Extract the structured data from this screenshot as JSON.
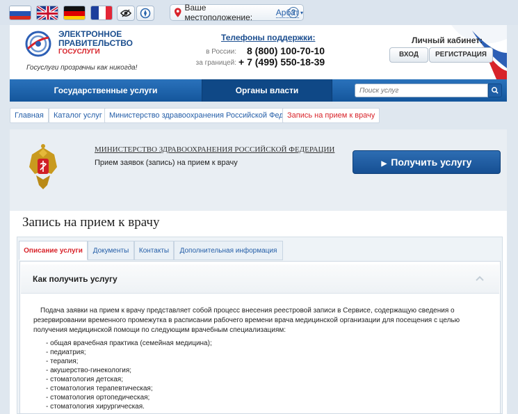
{
  "location": {
    "label": "Ваше местоположение:",
    "city": "Арбат",
    "help": "?"
  },
  "logo": {
    "line1": "ЭЛЕКТРОННОЕ",
    "line2": "ПРАВИТЕЛЬСТВО",
    "line3": "ГОСУСЛУГИ",
    "slogan": "Госуслуги прозрачны как никогда!"
  },
  "phones": {
    "title": "Телефоны поддержки:",
    "russia_label": "в России:",
    "russia_number": "8 (800) 100-70-10",
    "abroad_label": "за границей:",
    "abroad_number": "+ 7 (499) 550-18-39"
  },
  "cabinet": {
    "title": "Личный кабинет:",
    "login": "ВХОД",
    "register": "РЕГИСТРАЦИЯ"
  },
  "nav": {
    "services": "Государственные услуги",
    "authorities": "Органы власти",
    "search_placeholder": "Поиск услуг"
  },
  "breadcrumbs": [
    "Главная",
    "Каталог услуг",
    "Министерство здравоохранения Российской Федерации",
    "Запись на прием к врачу"
  ],
  "service": {
    "org": "МИНИСТЕРСТВО ЗДРАВООХРАНЕНИЯ РОССИЙСКОЙ ФЕДЕРАЦИИ",
    "name": "Прием заявок (запись) на прием к врачу",
    "get_button": "Получить услугу"
  },
  "page_title": "Запись на прием к врачу",
  "tabs": [
    "Описание услуги",
    "Документы",
    "Контакты",
    "Дополнительная информация"
  ],
  "accordion": {
    "title": "Как получить услугу"
  },
  "description": {
    "text": "Подача заявки на прием к врачу представляет собой процесс внесения реестровой записи в Сервисе, содержащую сведения о резервировании временного промежутка в расписании рабочего времени врача медицинской организации для посещения с целью получения медицинской помощи по следующим врачебным специализациям:",
    "items": [
      "- общая врачебная практика (семейная медицина);",
      "- педиатрия;",
      "- терапия;",
      "- акушерство-гинекология;",
      "- стоматология детская;",
      "- стоматология терапевтическая;",
      "- стоматология ортопедическая;",
      "- стоматология хирургическая."
    ]
  },
  "colors": {
    "brand_blue": "#1c5aa0",
    "accent_red": "#d8232a",
    "nav_blue": "#14569c"
  }
}
